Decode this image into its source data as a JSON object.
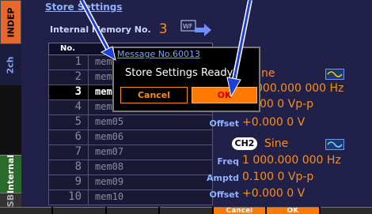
{
  "side_tabs": {
    "indep": "INDEP",
    "ch2": "2ch",
    "internal": "Internal",
    "usb": "USB"
  },
  "header": {
    "title": "Store Settings",
    "memory_label": "Internal Memory No.",
    "memory_value": "3",
    "wf_icon": "WF"
  },
  "memory_table": {
    "col_no": "No.",
    "rows": [
      {
        "no": "1",
        "name": "mem01"
      },
      {
        "no": "2",
        "name": "mem02"
      },
      {
        "no": "3",
        "name": "mem03"
      },
      {
        "no": "4",
        "name": "mem04"
      },
      {
        "no": "5",
        "name": "mem05"
      },
      {
        "no": "6",
        "name": "mem06"
      },
      {
        "no": "7",
        "name": "mem07"
      },
      {
        "no": "8",
        "name": "mem08"
      },
      {
        "no": "9",
        "name": "mem09"
      },
      {
        "no": "10",
        "name": "mem10"
      }
    ]
  },
  "ch1": {
    "wave_partial": "ne",
    "freq_partial": "000.000 000 Hz",
    "amptd_partial": "00 0 Vp-p",
    "offset_label": "Offset",
    "offset_value": "+0.000 0 V"
  },
  "ch2": {
    "badge": "CH2",
    "wave": "Sine",
    "freq_label": "Freq",
    "freq_value": "1 000.000 000 Hz",
    "amptd_label": "Amptd",
    "amptd_value": "0.100 0 Vp-p",
    "offset_label": "Offset",
    "offset_value": "+0.000 0 V"
  },
  "dialog": {
    "title": "Message No.60013",
    "message": "Store Settings Ready?",
    "cancel": "Cancel",
    "ok": "OK"
  },
  "softkeys": [
    "",
    "",
    "",
    "",
    "Cancel",
    "OK",
    ""
  ],
  "colors": {
    "accent_orange": "#ff8c1a",
    "panel_blue": "#202048",
    "label_blue": "#8fb2ff",
    "arrow_blue": "#1f3fd6"
  }
}
